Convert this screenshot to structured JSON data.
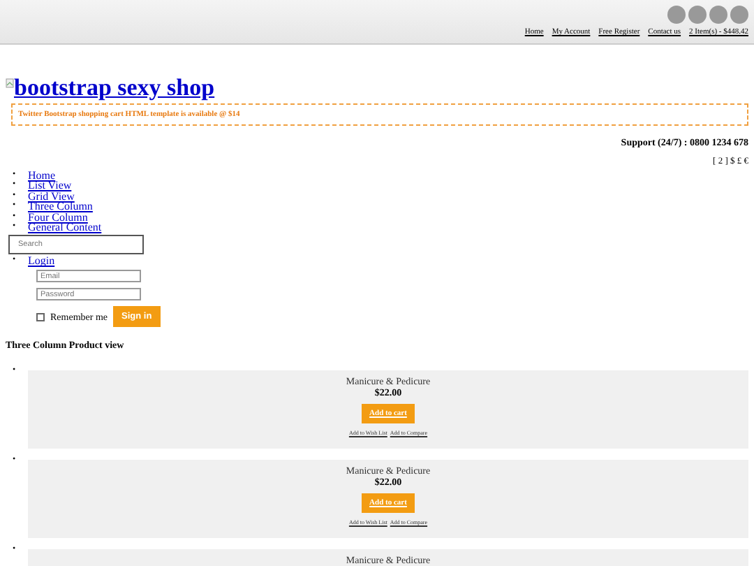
{
  "top_bar": {
    "social_icons": [
      {
        "kind": "circle"
      },
      {
        "kind": "circle"
      },
      {
        "kind": "circle"
      },
      {
        "kind": "circle"
      }
    ],
    "links": [
      "Home",
      "My Account",
      "Free Register",
      "Contact us",
      "2 Item(s) - $448.42"
    ]
  },
  "logo": {
    "text": "bootstrap sexy shop"
  },
  "banner": "Twitter Bootstrap shopping cart HTML template is available @ $14",
  "support": "Support (24/7) : 0800 1234 678",
  "currency": "[ 2 ] $ £ €",
  "nav": [
    {
      "bullet": "•",
      "label": "Home"
    },
    {
      "bullet": "•",
      "label": "List View"
    },
    {
      "bullet": "•",
      "label": "Grid View"
    },
    {
      "bullet": "•",
      "label": "Three Column"
    },
    {
      "bullet": "•",
      "label": "Four Column"
    },
    {
      "bullet": "•",
      "label": "General Content"
    }
  ],
  "search": {
    "placeholder": "Search"
  },
  "login": {
    "bullet": "•",
    "link": "Login",
    "email_placeholder": "Email",
    "password_placeholder": "Password",
    "remember": {
      "label": "Remember me",
      "checked": false
    },
    "button": "Sign in"
  },
  "heading": "Three Column Product view",
  "products": [
    {
      "bullet": "•",
      "name": "Manicure & Pedicure",
      "price": "$22.00",
      "button": "Add to cart",
      "links": [
        "Add to Wish List",
        "Add to Compare"
      ]
    },
    {
      "bullet": "•",
      "name": "Manicure & Pedicure",
      "price": "$22.00",
      "button": "Add to cart",
      "links": [
        "Add to Wish List",
        "Add to Compare"
      ]
    },
    {
      "bullet": "•",
      "name": "Manicure & Pedicure"
    }
  ]
}
